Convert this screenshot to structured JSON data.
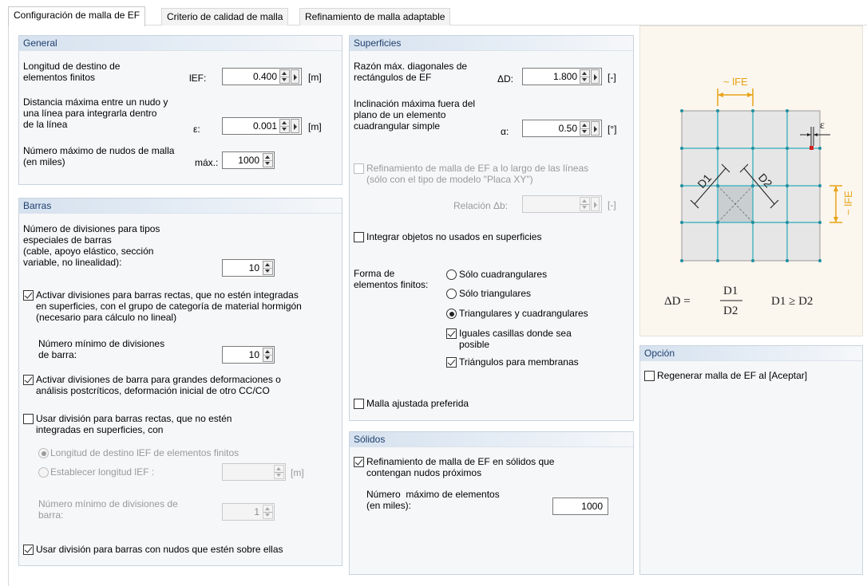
{
  "tabs": [
    {
      "label": "Configuración de malla de EF"
    },
    {
      "label": "Criterio de calidad de malla"
    },
    {
      "label": "Refinamiento de malla adaptable"
    }
  ],
  "general": {
    "title": "General",
    "target_length_label": "Longitud de destino de\nelementos finitos",
    "target_length_symbol": "lEF:",
    "target_length_value": "0.400",
    "target_length_unit": "[m]",
    "max_distance_label": "Distancia máxima entre un nudo y\nuna línea para integrarla dentro\nde la línea",
    "max_distance_symbol": "ε:",
    "max_distance_value": "0.001",
    "max_distance_unit": "[m]",
    "max_nodes_label": "Número máximo de nudos de malla\n(en miles)",
    "max_nodes_symbol": "máx.:",
    "max_nodes_value": "1000"
  },
  "barras": {
    "title": "Barras",
    "special_divisions_label": "Número de divisiones para tipos\nespeciales de barras\n(cable, apoyo elástico, sección\nvariable, no linealidad):",
    "special_divisions_value": "10",
    "activate_straight_label": "Activar divisiones para barras rectas, que no estén integradas\nen superficies, con el grupo de categoría de material hormigón\n(necesario para cálculo no lineal)",
    "activate_straight_checked": true,
    "min_divisions_label": "Número mínimo de divisiones\nde barra:",
    "min_divisions_value": "10",
    "large_deformation_label": "Activar divisiones de barra para grandes deformaciones o\nanálisis postcríticos, deformación inicial de otro CC/CO",
    "large_deformation_checked": true,
    "use_division_label": "Usar división para barras rectas, que no estén\nintegradas en superficies, con",
    "use_division_checked": false,
    "radio_target_length": "Longitud de destino lEF de elementos finitos",
    "radio_set_length": "Establecer longitud lEF :",
    "set_length_unit": "[m]",
    "min_div_bar_label": "Número mínimo de divisiones de\nbarra:",
    "min_div_bar_value": "1",
    "nodes_on_bars_label": "Usar división para barras con nudos que estén sobre ellas",
    "nodes_on_bars_checked": true
  },
  "superficies": {
    "title": "Superficies",
    "diag_ratio_label": "Razón máx. diagonales de\nrectángulos de EF",
    "diag_ratio_symbol": "ΔD:",
    "diag_ratio_value": "1.800",
    "diag_ratio_unit": "[-]",
    "inclination_label": "Inclinación máxima fuera del\nplano de un elemento\ncuadrangular simple",
    "inclination_symbol": "α:",
    "inclination_value": "0.50",
    "inclination_unit": "[°]",
    "refine_lines_label": "Refinamiento de malla de EF a lo largo de las líneas\n(sólo con el tipo de modelo \"Placa XY\")",
    "refine_lines_checked": false,
    "relation_label": "Relación Δb:",
    "relation_unit": "[-]",
    "integrate_unused_label": "Integrar objetos no usados en superficies",
    "integrate_unused_checked": false,
    "shape_label": "Forma de\nelementos finitos:",
    "shape_options": [
      "Sólo cuadrangulares",
      "Sólo triangulares",
      "Triangulares y cuadrangulares"
    ],
    "shape_selected": "Triangulares y cuadrangulares",
    "equal_cells_label": "Iguales casillas donde sea\nposible",
    "equal_cells_checked": true,
    "triangles_membranes_label": "Triángulos para membranas",
    "triangles_membranes_checked": true,
    "adjusted_mesh_label": "Malla ajustada preferida",
    "adjusted_mesh_checked": false
  },
  "solidos": {
    "title": "Sólidos",
    "refine_solids_label": "Refinamiento de malla de EF en sólidos que\ncontengan nudos próximos",
    "refine_solids_checked": true,
    "max_elements_label": "Número  máximo de elementos\n(en miles):",
    "max_elements_value": "1000"
  },
  "opcion": {
    "title": "Opción",
    "regenerate_label": "Regenerar malla de EF al [Aceptar]",
    "regenerate_checked": false
  },
  "diagram": {
    "lfe_top": "~ lFE",
    "lfe_side": "~ lFE",
    "epsilon": "ε",
    "d1": "D1",
    "d2": "D2",
    "formula_lhs": "ΔD =",
    "formula_num": "D1",
    "formula_den": "D2",
    "formula_cond": "D1 ≥ D2",
    "colors": {
      "accent": "#e8a317",
      "grid": "#4bb5c1",
      "node": "#1f8f9f",
      "red_node": "#d32020"
    }
  }
}
